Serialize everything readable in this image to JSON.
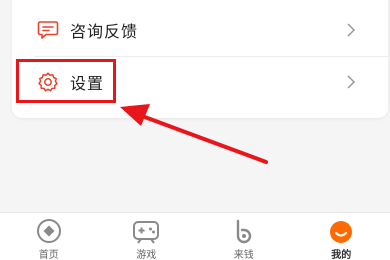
{
  "menu": {
    "feedback_label": "咨询反馈",
    "settings_label": "设置"
  },
  "tabs": [
    {
      "label": "首页",
      "icon": "home-icon",
      "active": false
    },
    {
      "label": "游戏",
      "icon": "gamepad-icon",
      "active": false
    },
    {
      "label": "来钱",
      "icon": "b-coin-icon",
      "active": false
    },
    {
      "label": "我的",
      "icon": "profile-icon",
      "active": true
    }
  ],
  "colors": {
    "accent": "#e8422a",
    "highlight": "#e8151b",
    "profile_active": "#ff6a00"
  }
}
